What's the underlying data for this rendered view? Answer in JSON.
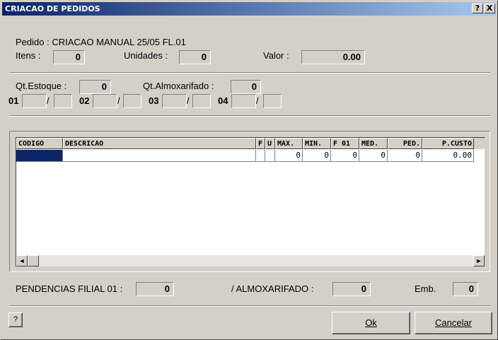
{
  "window": {
    "title": "CRIACAO DE PEDIDOS",
    "help_btn": "?",
    "close_btn": "X"
  },
  "header": {
    "pedido_label": "Pedido : CRIACAO MANUAL 25/05 FL.01",
    "itens_label": "Itens :",
    "itens_value": "0",
    "unidades_label": "Unidades :",
    "unidades_value": "0",
    "valor_label": "Valor :",
    "valor_value": "0.00"
  },
  "stock": {
    "qt_estoque_label": "Qt.Estoque :",
    "qt_estoque_value": "0",
    "qt_almox_label": "Qt.Almoxarifado :",
    "qt_almox_value": "0",
    "branches": [
      {
        "label": "01",
        "sep": "/"
      },
      {
        "label": "02",
        "sep": "/"
      },
      {
        "label": "03",
        "sep": "/"
      },
      {
        "label": "04",
        "sep": "/"
      }
    ]
  },
  "grid": {
    "columns": [
      "CODIGO",
      "DESCRICAO",
      "F",
      "U",
      "MAX.",
      "MIN.",
      "F 01",
      "MED.",
      "PED.",
      "P.CUSTO"
    ],
    "rows": [
      [
        "",
        "",
        "",
        "",
        "0",
        "0",
        "0",
        "0",
        "0",
        "0.00"
      ]
    ],
    "scroll_left": "◄",
    "scroll_right": "►"
  },
  "footer": {
    "pend_label": "PENDENCIAS FILIAL 01 :",
    "pend_value": "0",
    "almox_label": "/  ALMOXARIFADO :",
    "almox_value": "0",
    "emb_label": "Emb.",
    "emb_value": "0"
  },
  "buttons": {
    "help": "?",
    "ok": "Ok",
    "cancel": "Cancelar"
  },
  "colors": {
    "selected_cell": "#0a246a",
    "titlebar_start": "#0a246a",
    "titlebar_end": "#a6caf0"
  }
}
